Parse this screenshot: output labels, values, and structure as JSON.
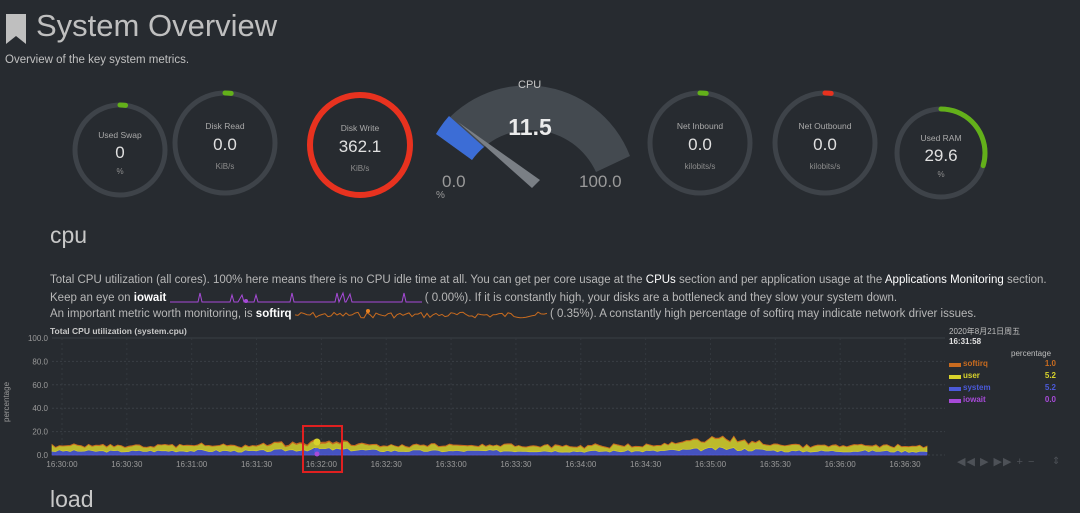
{
  "header": {
    "title": "System Overview",
    "subtitle": "Overview of the key system metrics."
  },
  "gauges": [
    {
      "label": "Used Swap",
      "value": "0",
      "unit": "%",
      "percent": 0.02,
      "color": "#63b01a"
    },
    {
      "label": "Disk Read",
      "value": "0.0",
      "unit": "KiB/s",
      "percent": 0.02,
      "color": "#63b01a"
    },
    {
      "label": "Disk Write",
      "value": "362.1",
      "unit": "KiB/s",
      "percent": 1.0,
      "color": "#e8321f"
    },
    {
      "label": "Net Inbound",
      "value": "0.0",
      "unit": "kilobits/s",
      "percent": 0.02,
      "color": "#63b01a"
    },
    {
      "label": "Net Outbound",
      "value": "0.0",
      "unit": "kilobits/s",
      "percent": 0.02,
      "color": "#e8321f"
    },
    {
      "label": "Used RAM",
      "value": "29.6",
      "unit": "%",
      "percent": 0.296,
      "color": "#63b01a"
    }
  ],
  "cpu_gauge": {
    "title": "CPU",
    "value": "11.5",
    "min": "0.0",
    "max": "100.0",
    "unit": "%",
    "percent": 0.115,
    "color": "#3c6dd6"
  },
  "section": {
    "heading": "cpu",
    "line1_pre": "Total CPU utilization (all cores). 100% here means there is no CPU idle time at all. You can get per core usage at the ",
    "line1_link1": "CPUs",
    "line1_mid": " section and per application usage at the ",
    "line1_link2": "Applications Monitoring",
    "line1_post": " section.",
    "line2_pre": "Keep an eye on ",
    "line2_hl": "iowait",
    "line2_val": "(      0.00%). If it is constantly high, your disks are a bottleneck and they slow your system down.",
    "line3_pre": "An important metric worth monitoring, is ",
    "line3_hl": "softirq",
    "line3_val": "(      0.35%). A constantly high percentage of softirq may indicate network driver issues."
  },
  "chart": {
    "title": "Total CPU utilization (system.cpu)",
    "ylabel": "percentage",
    "yticks": [
      "100.0",
      "80.0",
      "60.0",
      "40.0",
      "20.0",
      "0.0"
    ],
    "legend_date": "2020年8月21日周五",
    "legend_time": "16:31:58",
    "legend_units": "percentage",
    "controls": "◀◀ ▶ ▶▶ + −",
    "scroll_handle": "⇕",
    "next_heading": "load"
  },
  "chart_data": {
    "type": "area",
    "title": "Total CPU utilization (system.cpu)",
    "ylabel": "percentage",
    "ylim": [
      0,
      100
    ],
    "x": [
      "16:30:00",
      "16:30:30",
      "16:31:00",
      "16:31:30",
      "16:32:00",
      "16:32:30",
      "16:33:00",
      "16:33:30",
      "16:34:00",
      "16:34:30",
      "16:35:00",
      "16:35:30",
      "16:36:00",
      "16:36:30"
    ],
    "series": [
      {
        "name": "softirq",
        "color": "#c86b1f",
        "values": [
          0.4,
          0.4,
          0.3,
          0.4,
          1.0,
          0.3,
          0.4,
          0.3,
          0.4,
          0.3,
          0.5,
          0.3,
          0.4,
          0.3
        ]
      },
      {
        "name": "user",
        "color": "#d8d32b",
        "values": [
          4.5,
          4.0,
          4.8,
          4.2,
          5.2,
          4.6,
          4.1,
          4.9,
          4.3,
          4.5,
          8.0,
          4.2,
          4.4,
          4.0
        ]
      },
      {
        "name": "system",
        "color": "#4b5ad9",
        "values": [
          3.5,
          3.2,
          3.8,
          3.3,
          5.2,
          3.6,
          3.4,
          3.7,
          3.2,
          3.5,
          5.5,
          3.3,
          3.5,
          3.1
        ]
      },
      {
        "name": "iowait",
        "color": "#a74ad8",
        "values": [
          0.0,
          0.0,
          0.0,
          0.0,
          0.0,
          0.0,
          0.0,
          0.0,
          0.0,
          0.0,
          0.0,
          0.0,
          0.0,
          0.0
        ]
      }
    ],
    "legend_values": [
      "1.0",
      "5.2",
      "5.2",
      "0.0"
    ],
    "grid": true,
    "legend_position": "right"
  }
}
